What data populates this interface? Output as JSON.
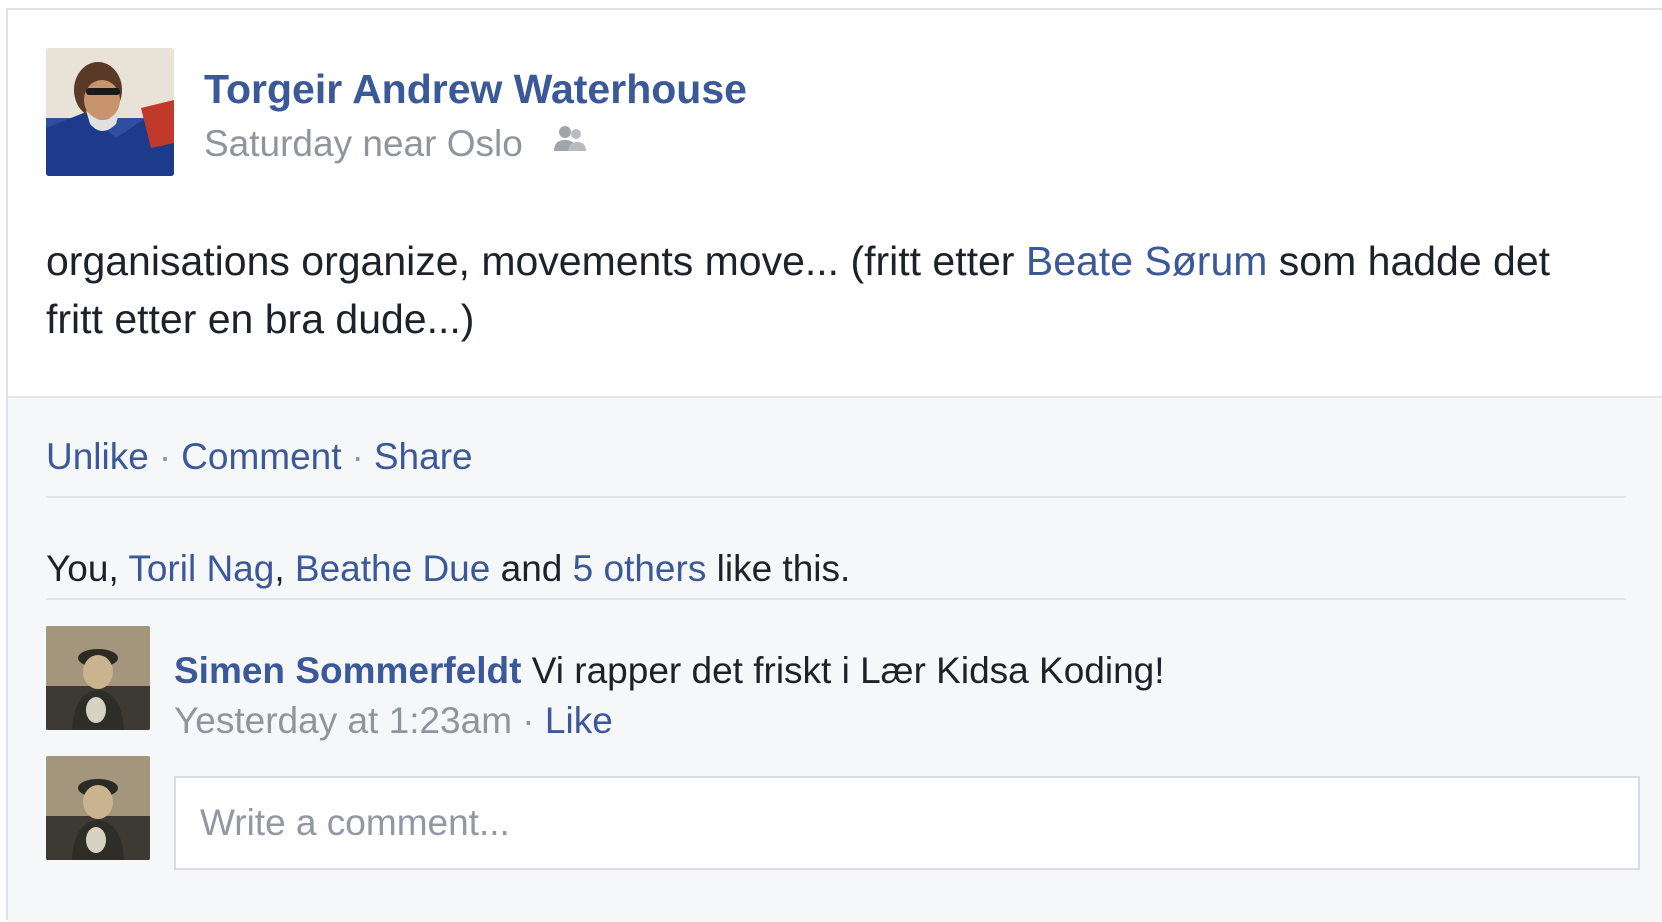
{
  "post": {
    "author": "Torgeir Andrew Waterhouse",
    "time": "Saturday near Oslo",
    "audience_icon": "friends-icon",
    "text_before": "organisations organize, movements move... (fritt etter ",
    "text_link": "Beate Sørum",
    "text_after": " som hadde det fritt etter en bra dude...)"
  },
  "actions": {
    "unlike": "Unlike",
    "comment": "Comment",
    "share": "Share",
    "separator": "·"
  },
  "likes": {
    "you": "You, ",
    "person1": "Toril Nag",
    "comma": ", ",
    "person2": "Beathe Due",
    "and": " and ",
    "others": "5 others",
    "suffix": " like this."
  },
  "comment": {
    "author": "Simen Sommerfeldt",
    "text": " Vi rapper det friskt i Lær Kidsa Koding!",
    "time": "Yesterday at 1:23am",
    "separator": " · ",
    "like": "Like"
  },
  "composer": {
    "placeholder": "Write a comment..."
  },
  "colors": {
    "link": "#3b5998",
    "meta": "#90949c",
    "feedback_bg": "#f6f7f9"
  }
}
